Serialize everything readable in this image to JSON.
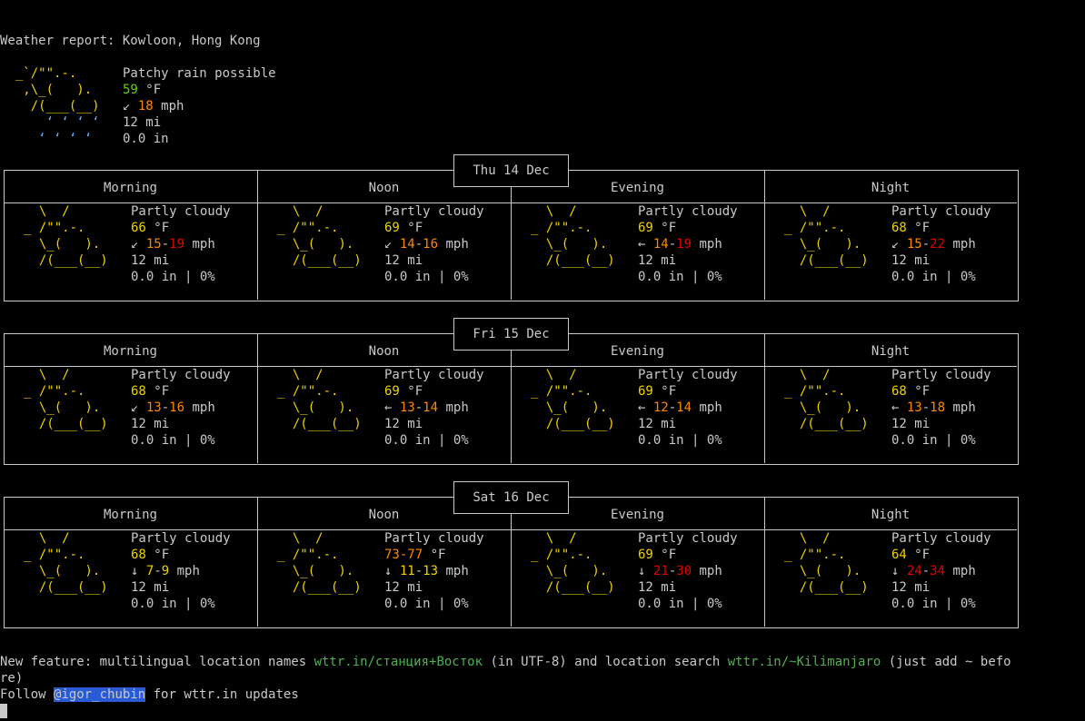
{
  "header": {
    "title": "Weather report: Kowloon, Hong Kong"
  },
  "current": {
    "condition": "Patchy rain possible",
    "temp": "59",
    "temp_unit": "°F",
    "wind_arrow": "↙",
    "wind": "18",
    "wind_unit": "mph",
    "visibility": "12 mi",
    "precip": "0.0 in"
  },
  "art": {
    "rain": [
      "  _`/\"\".-.  ",
      "   ,\\_(   ).  ",
      "    /(___(__) ",
      "      ‘ ‘ ‘ ‘ ",
      "     ‘ ‘ ‘ ‘  "
    ],
    "cloud": [
      "  \\  /      ",
      "_ /\"\".-.    ",
      "  \\_(   ).  ",
      "  /(___(__) "
    ]
  },
  "parts": [
    "Morning",
    "Noon",
    "Evening",
    "Night"
  ],
  "days": [
    {
      "title": "Thu 14 Dec",
      "cells": [
        {
          "cond": "Partly cloudy",
          "temp": "66",
          "tc": "y",
          "arrow": "↙",
          "w1": "15",
          "w1c": "o",
          "w2": "19",
          "w2c": "r",
          "vis": "12 mi",
          "precip": "0.0 in | 0%"
        },
        {
          "cond": "Partly cloudy",
          "temp": "69",
          "tc": "y",
          "arrow": "↙",
          "w1": "14",
          "w1c": "o",
          "w2": "16",
          "w2c": "o",
          "vis": "12 mi",
          "precip": "0.0 in | 0%"
        },
        {
          "cond": "Partly cloudy",
          "temp": "69",
          "tc": "y",
          "arrow": "←",
          "w1": "14",
          "w1c": "o",
          "w2": "19",
          "w2c": "r",
          "vis": "12 mi",
          "precip": "0.0 in | 0%"
        },
        {
          "cond": "Partly cloudy",
          "temp": "68",
          "tc": "y",
          "arrow": "↙",
          "w1": "15",
          "w1c": "o",
          "w2": "22",
          "w2c": "r",
          "vis": "12 mi",
          "precip": "0.0 in | 0%"
        }
      ]
    },
    {
      "title": "Fri 15 Dec",
      "cells": [
        {
          "cond": "Partly cloudy",
          "temp": "68",
          "tc": "y",
          "arrow": "↙",
          "w1": "13",
          "w1c": "o",
          "w2": "16",
          "w2c": "o",
          "vis": "12 mi",
          "precip": "0.0 in | 0%"
        },
        {
          "cond": "Partly cloudy",
          "temp": "69",
          "tc": "y",
          "arrow": "←",
          "w1": "13",
          "w1c": "o",
          "w2": "14",
          "w2c": "o",
          "vis": "12 mi",
          "precip": "0.0 in | 0%"
        },
        {
          "cond": "Partly cloudy",
          "temp": "69",
          "tc": "y",
          "arrow": "←",
          "w1": "12",
          "w1c": "o",
          "w2": "14",
          "w2c": "o",
          "vis": "12 mi",
          "precip": "0.0 in | 0%"
        },
        {
          "cond": "Partly cloudy",
          "temp": "68",
          "tc": "y",
          "arrow": "←",
          "w1": "13",
          "w1c": "o",
          "w2": "18",
          "w2c": "o",
          "vis": "12 mi",
          "precip": "0.0 in | 0%"
        }
      ]
    },
    {
      "title": "Sat 16 Dec",
      "cells": [
        {
          "cond": "Partly cloudy",
          "temp": "68",
          "tc": "y",
          "arrow": "↓",
          "w1": "7",
          "w1c": "y",
          "w2": "9",
          "w2c": "y",
          "vis": "12 mi",
          "precip": "0.0 in | 0%"
        },
        {
          "cond": "Partly cloudy",
          "temp": "73-77",
          "tc": "o",
          "arrow": "↓",
          "w1": "11",
          "w1c": "y",
          "w2": "13",
          "w2c": "y",
          "vis": "12 mi",
          "precip": "0.0 in | 0%"
        },
        {
          "cond": "Partly cloudy",
          "temp": "69",
          "tc": "y",
          "arrow": "↓",
          "w1": "21",
          "w1c": "r",
          "w2": "30",
          "w2c": "r",
          "vis": "12 mi",
          "precip": "0.0 in | 0%"
        },
        {
          "cond": "Partly cloudy",
          "temp": "64",
          "tc": "y",
          "arrow": "↓",
          "w1": "24",
          "w1c": "r",
          "w2": "34",
          "w2c": "r",
          "vis": "12 mi",
          "precip": "0.0 in | 0%"
        }
      ]
    }
  ],
  "footer": {
    "line1_a": "New feature: multilingual location names ",
    "link1": "wttr.in/станция+Восток",
    "line1_b": " (in UTF-8) and location search ",
    "link2": "wttr.in/~Kilimanjaro",
    "line1_c": " (just add ~ befo",
    "line2": "re)",
    "follow": "Follow ",
    "handle": "@igor_chubin",
    "follow_rest": " for wttr.in updates"
  },
  "colors": {
    "yellow": "#f0d000",
    "orange": "#ff8700",
    "red": "#e00000",
    "green": "#5fd700",
    "cyan": "#5fafff",
    "link": "#4eb04e"
  }
}
